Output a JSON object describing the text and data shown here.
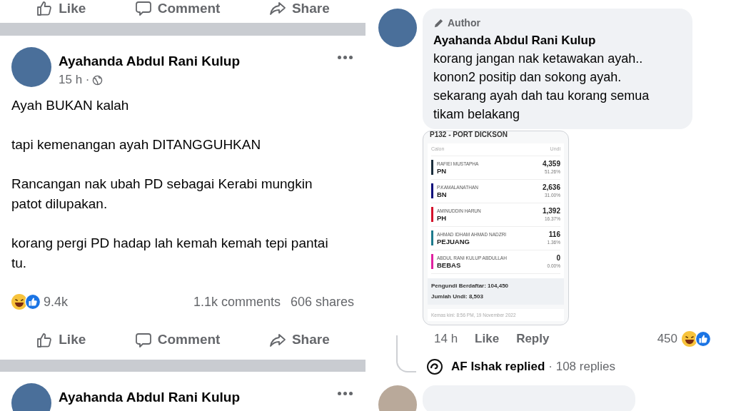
{
  "feed": {
    "top_actions": [
      {
        "kind": "like",
        "label": "Like"
      },
      {
        "kind": "comment",
        "label": "Comment"
      },
      {
        "kind": "share",
        "label": "Share"
      }
    ],
    "post": {
      "author": "Ayahanda Abdul Rani Kulup",
      "time": "15 h ·",
      "paragraphs": [
        "Ayah BUKAN kalah",
        "tapi kemenangan ayah DITANGGUHKAN",
        "Rancangan nak ubah PD sebagai Kerabi mungkin patot dilupakan.",
        "korang pergi PD hadap lah kemah kemah tepi pantai tu."
      ],
      "reactions": "9.4k",
      "comments": "1.1k comments",
      "shares": "606 shares",
      "actions": [
        {
          "kind": "like",
          "label": "Like"
        },
        {
          "kind": "comment",
          "label": "Comment"
        },
        {
          "kind": "share",
          "label": "Share"
        }
      ]
    },
    "next_post": {
      "author": "Ayahanda Abdul Rani Kulup"
    }
  },
  "comment": {
    "badge": "Author",
    "author": "Ayahanda Abdul Rani Kulup",
    "text": "korang jangan nak ketawakan ayah.. konon2 positip  dan sokong ayah. sekarang ayah dah tau korang semua tikam belakang",
    "result": {
      "title": "P132 - PORT DICKSON",
      "col_candidate": "Calon",
      "col_votes": "Undi",
      "rows": [
        {
          "name": "RAFIEI MUSTAPHA",
          "party": "PN",
          "votes": "4,359",
          "percent": "51.26%",
          "color": "#1b2e3c"
        },
        {
          "name": "P.KAMALANATHAN",
          "party": "BN",
          "votes": "2,636",
          "percent": "31.00%",
          "color": "#0b0b7a"
        },
        {
          "name": "AMINUDDIN HARUN",
          "party": "PH",
          "votes": "1,392",
          "percent": "16.37%",
          "color": "#d4102a"
        },
        {
          "name": "AHMAD IDHAM AHMAD NADZRI",
          "party": "PEJUANG",
          "votes": "116",
          "percent": "1.36%",
          "color": "#1d7a8c"
        },
        {
          "name": "ABDUL RANI KULUP ABDULLAH",
          "party": "BEBAS",
          "votes": "0",
          "percent": "0.00%",
          "color": "#e020a0"
        }
      ],
      "registered": "Pengundi Berdaftar: 104,450",
      "total": "Jumlah Undi: 8,503",
      "updated": "Kemas kini: 8:56 PM, 19 November 2022"
    },
    "time": "14 h",
    "actions": [
      "Like",
      "Reply"
    ],
    "reactions": "450",
    "replies": {
      "who": "AF Ishak replied",
      "count": "· 108 replies"
    }
  }
}
